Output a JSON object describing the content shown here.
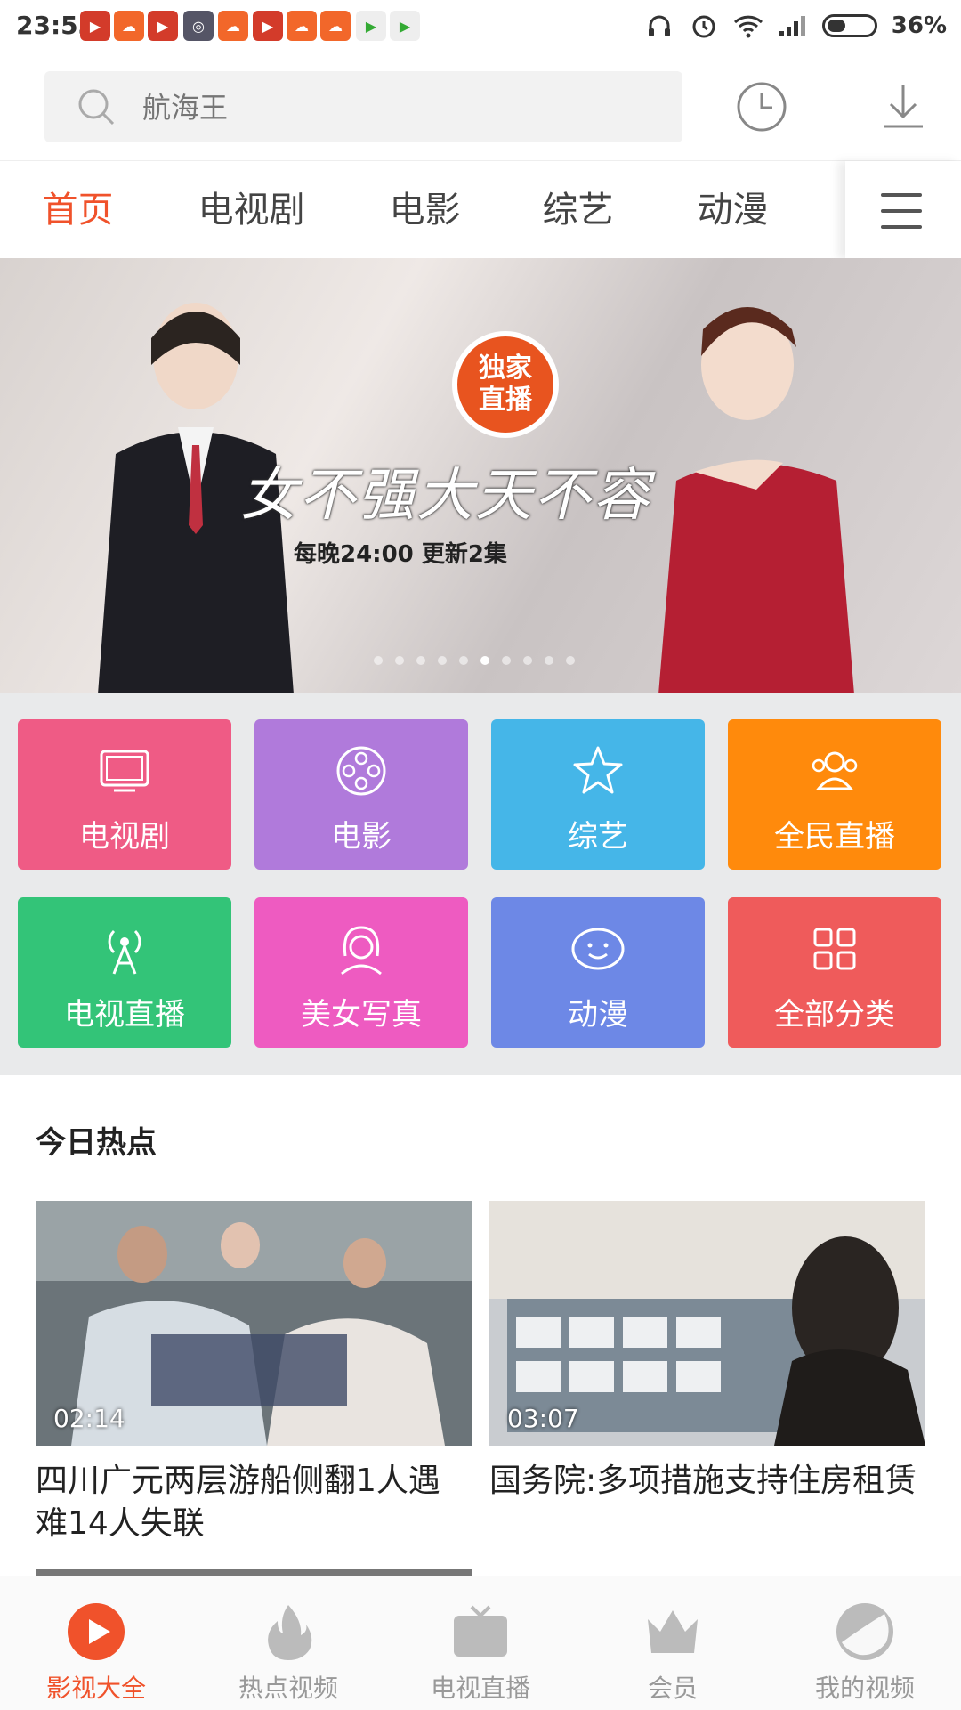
{
  "status_bar": {
    "time": "23:53",
    "battery_percent": "36%",
    "battery_level": 0.36,
    "notification_icons": [
      "youtube-icon",
      "cloud-app-icon",
      "youtube-icon",
      "qq-icon",
      "cloud-app-icon",
      "youtube-icon",
      "cloud-app-icon",
      "cloud-app-icon",
      "play-store-icon",
      "play-store-icon"
    ]
  },
  "search": {
    "placeholder": "航海王"
  },
  "tabs": [
    {
      "label": "首页",
      "active": true
    },
    {
      "label": "电视剧",
      "active": false
    },
    {
      "label": "电影",
      "active": false
    },
    {
      "label": "综艺",
      "active": false
    },
    {
      "label": "动漫",
      "active": false
    }
  ],
  "banner": {
    "badge_line1": "独家",
    "badge_line2": "直播",
    "title": "女不强大天不容",
    "subtitle": "每晚24:00 更新2集",
    "dot_count": 10,
    "active_dot": 5
  },
  "categories": [
    {
      "label": "电视剧",
      "icon": "tv-icon",
      "color": "#ef5b85"
    },
    {
      "label": "电影",
      "icon": "film-reel-icon",
      "color": "#b07adb"
    },
    {
      "label": "综艺",
      "icon": "star-icon",
      "color": "#45b6e8"
    },
    {
      "label": "全民直播",
      "icon": "people-live-icon",
      "color": "#ff8a0c"
    },
    {
      "label": "电视直播",
      "icon": "broadcast-tower-icon",
      "color": "#33c478"
    },
    {
      "label": "美女写真",
      "icon": "girl-face-icon",
      "color": "#ee5bc1"
    },
    {
      "label": "动漫",
      "icon": "smile-face-icon",
      "color": "#6d88e6"
    },
    {
      "label": "全部分类",
      "icon": "grid-icon",
      "color": "#ef5b5b"
    }
  ],
  "section": {
    "title": "今日热点"
  },
  "videos": [
    {
      "duration": "02:14",
      "title": "四川广元两层游船侧翻1人遇难14人失联"
    },
    {
      "duration": "03:07",
      "title": "国务院:多项措施支持住房租赁"
    }
  ],
  "bottom_nav": [
    {
      "label": "影视大全",
      "icon": "play-circle-icon",
      "active": true
    },
    {
      "label": "热点视频",
      "icon": "flame-icon",
      "active": false
    },
    {
      "label": "电视直播",
      "icon": "tv-icon",
      "active": false
    },
    {
      "label": "会员",
      "icon": "crown-icon",
      "active": false
    },
    {
      "label": "我的视频",
      "icon": "profile-circle-icon",
      "active": false
    }
  ],
  "colors": {
    "accent": "#f0522b",
    "nav_inactive": "#bbbbbb"
  }
}
